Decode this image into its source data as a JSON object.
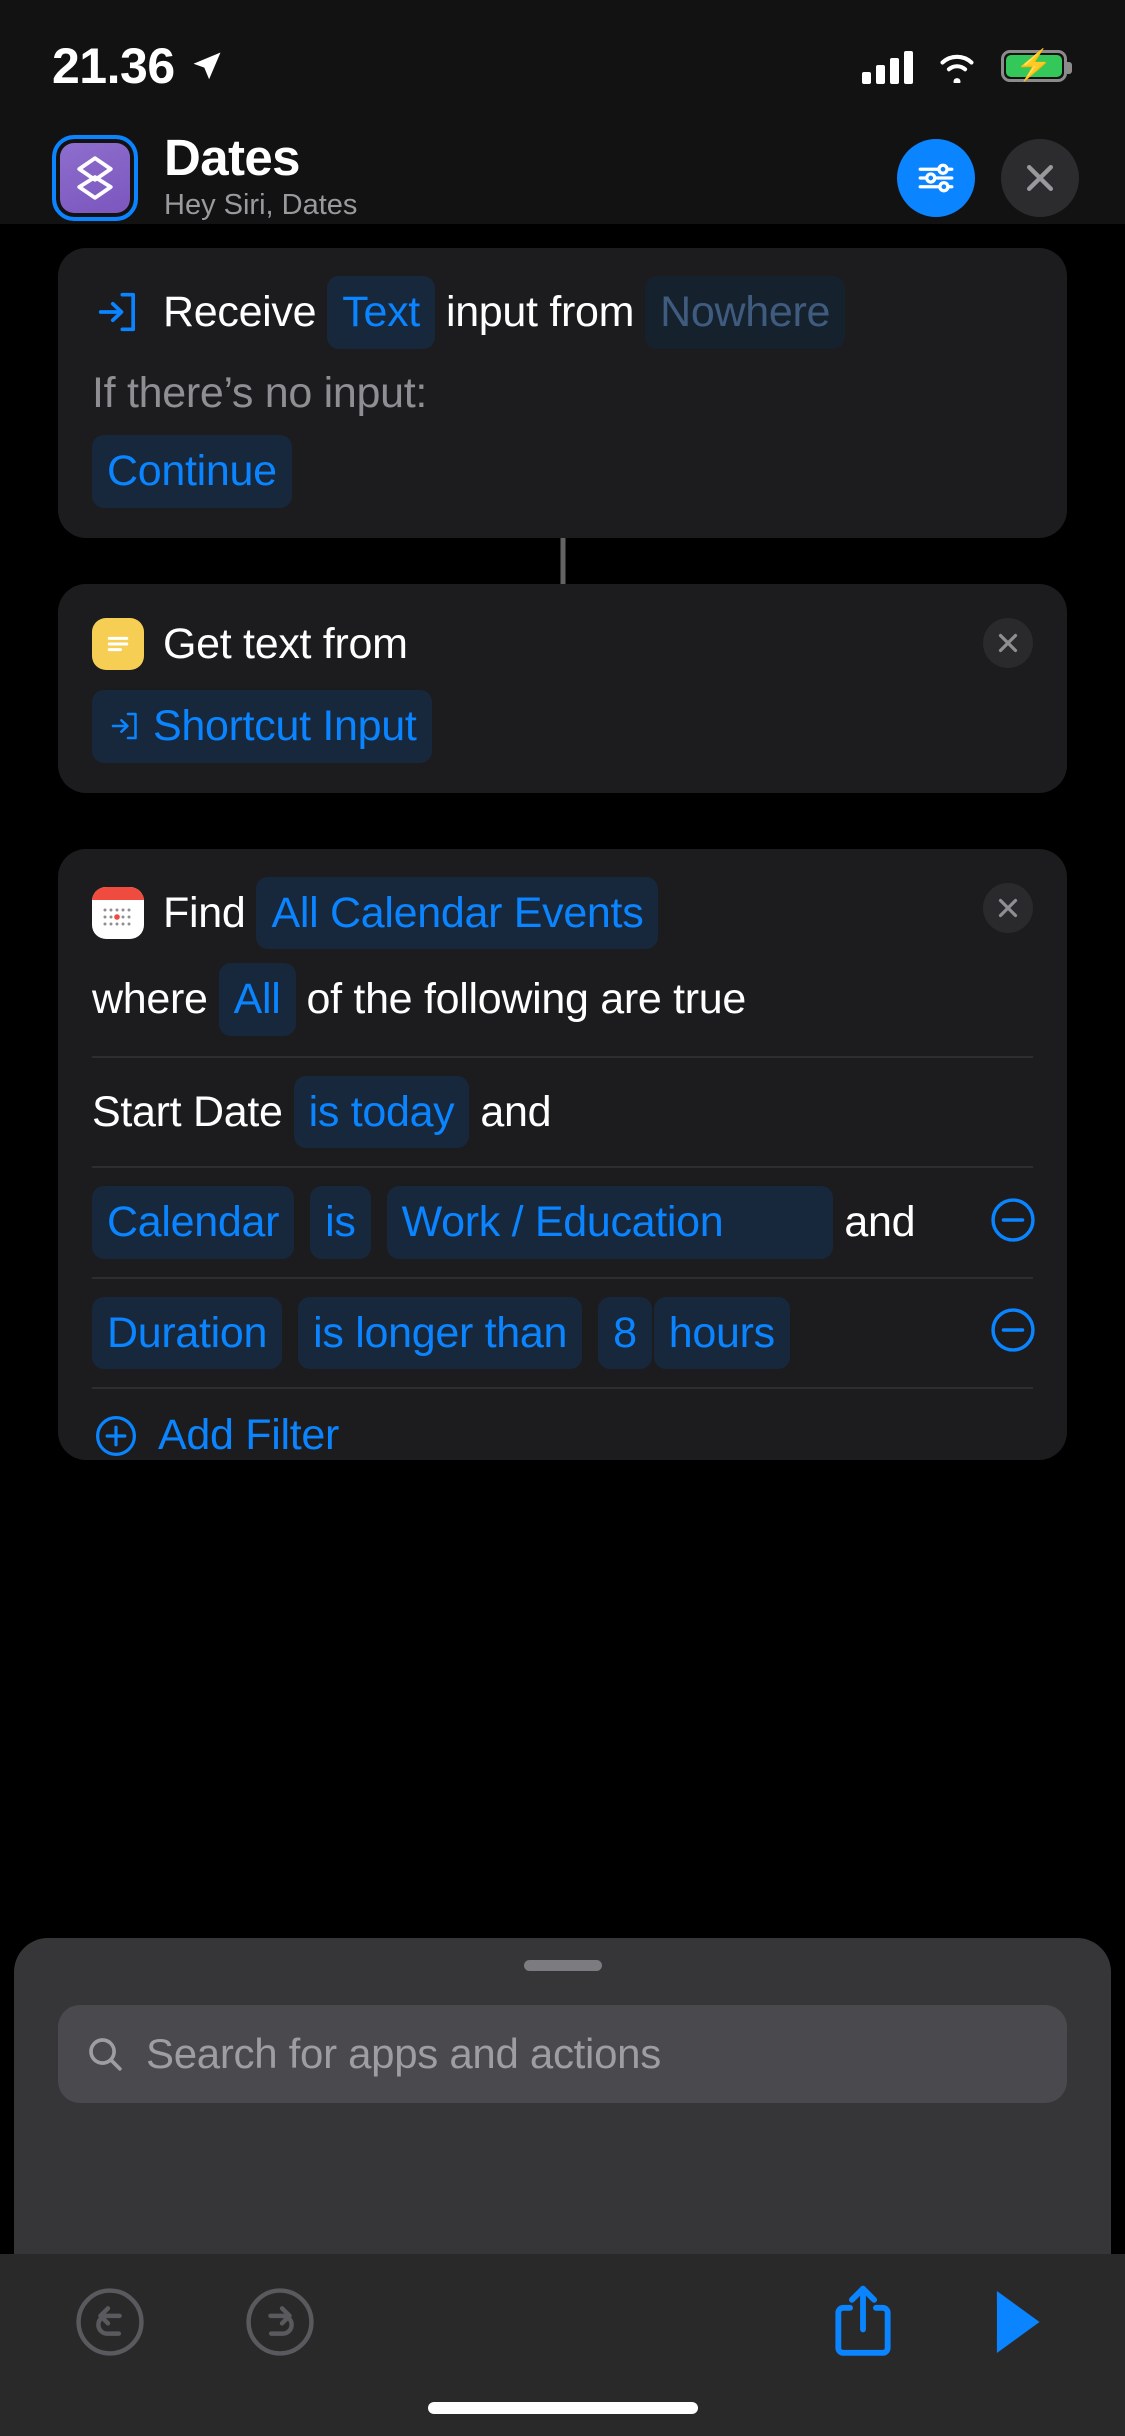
{
  "status_bar": {
    "time": "21.36",
    "location_icon": "location-arrow-icon",
    "signal_icon": "cellular-signal-icon",
    "wifi_icon": "wifi-icon",
    "battery_icon": "battery-charging-icon",
    "battery_color": "#34C759"
  },
  "header": {
    "app_icon": "dates-shortcut-icon",
    "title": "Dates",
    "subtitle": "Hey Siri, Dates",
    "settings_icon": "sliders-icon",
    "close_icon": "close-icon",
    "accent_color": "#0a84ff"
  },
  "actions": [
    {
      "id": "receive-input",
      "icon": "import-input-icon",
      "tokens": [
        {
          "t": "word",
          "v": "Receive"
        },
        {
          "t": "pill",
          "v": "Text"
        },
        {
          "t": "word",
          "v": "input from"
        },
        {
          "t": "pill-dim",
          "v": "Nowhere"
        }
      ],
      "subline_label": "If there’s no input:",
      "subline_pill": "Continue"
    },
    {
      "id": "get-text-from",
      "icon": "text-lines-icon",
      "delete_icon": "close-icon",
      "tokens": [
        {
          "t": "word",
          "v": "Get text from"
        },
        {
          "t": "pill-input",
          "v": "Shortcut Input"
        }
      ]
    },
    {
      "id": "find-calendar-events",
      "icon": "calendar-icon",
      "delete_icon": "close-icon",
      "tokens": [
        {
          "t": "word",
          "v": "Find"
        },
        {
          "t": "pill",
          "v": "All Calendar Events"
        }
      ],
      "condition_line": [
        {
          "t": "word",
          "v": "where"
        },
        {
          "t": "pill",
          "v": "All"
        },
        {
          "t": "word",
          "v": "of the following are true"
        }
      ],
      "filters": [
        {
          "id": "filter-start-date",
          "removable": false,
          "tokens": [
            {
              "t": "word",
              "v": "Start Date"
            },
            {
              "t": "pill",
              "v": "is today"
            },
            {
              "t": "word",
              "v": "and"
            }
          ]
        },
        {
          "id": "filter-calendar",
          "removable": true,
          "remove_icon": "minus-circle-icon",
          "tokens": [
            {
              "t": "pill",
              "v": "Calendar"
            },
            {
              "t": "pill",
              "v": "is"
            },
            {
              "t": "pill-wide",
              "v": "Work / Education"
            },
            {
              "t": "word",
              "v": "and"
            }
          ]
        },
        {
          "id": "filter-duration",
          "removable": true,
          "remove_icon": "minus-circle-icon",
          "tokens": [
            {
              "t": "pill",
              "v": "Duration"
            },
            {
              "t": "pill",
              "v": "is longer than"
            },
            {
              "t": "pill",
              "v": "8"
            },
            {
              "t": "pill",
              "v": "hours"
            }
          ]
        }
      ],
      "add_filter_icon": "plus-circle-icon",
      "add_filter_label": "Add Filter"
    }
  ],
  "sheet": {
    "grabber": "sheet-grabber",
    "search_icon": "search-icon",
    "search_value": "",
    "search_placeholder": "Search for apps and actions"
  },
  "toolbar": {
    "undo_icon": "undo-icon",
    "redo_icon": "redo-icon",
    "share_icon": "share-icon",
    "play_icon": "play-icon",
    "home_indicator": "home-indicator"
  }
}
